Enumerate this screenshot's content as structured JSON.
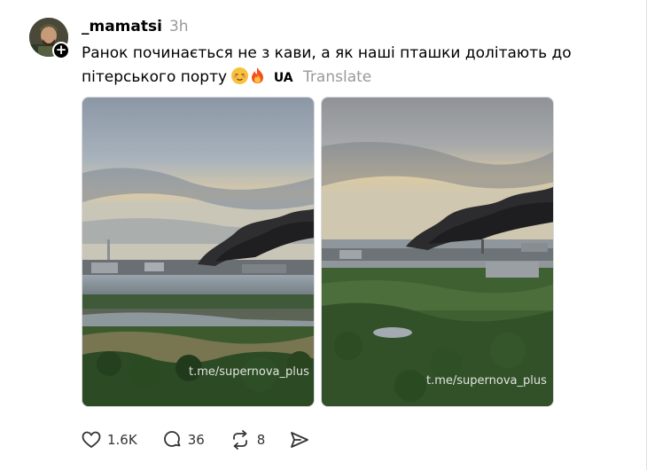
{
  "post": {
    "username": "_mamatsi",
    "time": "3h",
    "text_main": "Ранок починається не з кави, а як наші пташки долітають до пітерського порту",
    "lang_tag": "UA",
    "translate_label": "Translate",
    "follow_symbol": "+",
    "emojis": [
      "relieved-face",
      "fire"
    ]
  },
  "media": [
    {
      "watermark": "t.me/supernova_plus"
    },
    {
      "watermark": "t.me/supernova_plus"
    }
  ],
  "actions": {
    "likes": "1.6K",
    "comments": "36",
    "reposts": "8"
  },
  "icons": {
    "like": "heart-icon",
    "comment": "comment-icon",
    "repost": "repost-icon",
    "share": "send-icon"
  }
}
